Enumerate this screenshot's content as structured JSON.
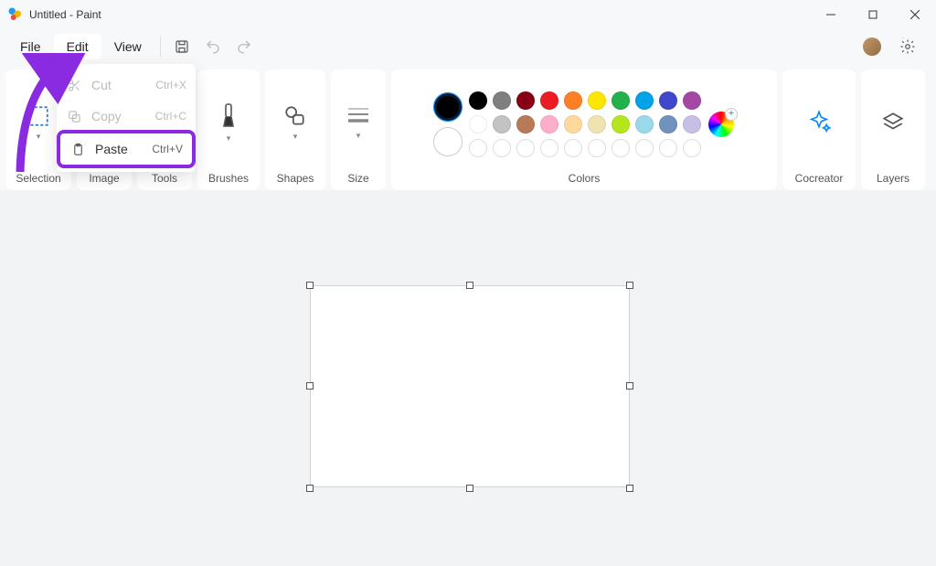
{
  "window": {
    "title": "Untitled - Paint"
  },
  "menubar": {
    "file": "File",
    "edit": "Edit",
    "view": "View"
  },
  "editMenu": {
    "cut": {
      "label": "Cut",
      "shortcut": "Ctrl+X"
    },
    "copy": {
      "label": "Copy",
      "shortcut": "Ctrl+C"
    },
    "paste": {
      "label": "Paste",
      "shortcut": "Ctrl+V"
    }
  },
  "ribbon": {
    "selection": "Selection",
    "image": "Image",
    "tools": "Tools",
    "brushes": "Brushes",
    "shapes": "Shapes",
    "size": "Size",
    "colors": "Colors",
    "cocreator": "Cocreator",
    "layers": "Layers"
  },
  "colors": {
    "row1": [
      "#000000",
      "#7f7f7f",
      "#880015",
      "#ed1c24",
      "#ff7f27",
      "#ffe600",
      "#22b14c",
      "#00a2e8",
      "#3f48cc",
      "#a349a4"
    ],
    "row2": [
      "#ffffff",
      "#c3c3c3",
      "#b97a57",
      "#ffaec9",
      "#ffd89c",
      "#efe4b0",
      "#b5e61d",
      "#99d9ea",
      "#7092be",
      "#c8bfe7"
    ]
  }
}
